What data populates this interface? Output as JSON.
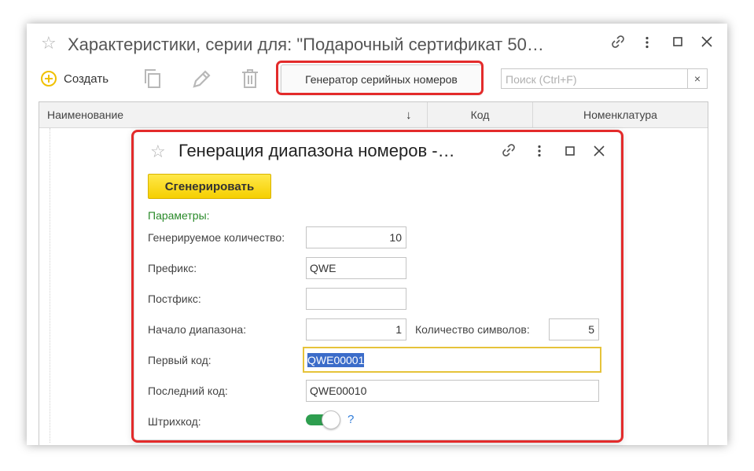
{
  "main_window": {
    "title": "Характеристики, серии для: \"Подарочный сертификат 50…",
    "toolbar": {
      "create_label": "Создать",
      "generator_button_label": "Генератор серийных номеров",
      "search_placeholder": "Поиск (Ctrl+F)",
      "search_clear": "×"
    },
    "grid": {
      "columns": [
        "Наименование",
        "Код",
        "Номенклатура"
      ],
      "sort_indicator": "↓"
    }
  },
  "dialog": {
    "title": "Генерация диапазона номеров -…",
    "generate_button_label": "Сгенерировать",
    "params_group_label": "Параметры:",
    "fields": {
      "quantity_label": "Генерируемое количество:",
      "quantity_value": "10",
      "prefix_label": "Префикс:",
      "prefix_value": "QWE",
      "postfix_label": "Постфикс:",
      "postfix_value": "",
      "range_start_label": "Начало диапазона:",
      "range_start_value": "1",
      "symbols_count_label": "Количество символов:",
      "symbols_count_value": "5",
      "first_code_label": "Первый код:",
      "first_code_value": "QWE00001",
      "last_code_label": "Последний код:",
      "last_code_value": "QWE00010",
      "barcode_label": "Штрихкод:",
      "barcode_enabled": true,
      "help_mark": "?"
    }
  },
  "colors": {
    "highlight_frame": "#e32b2b",
    "generate_button": "#f5cf00",
    "params_label": "#2a8a2a",
    "toggle_on": "#2e9e4f",
    "selection": "#3b6cc9"
  }
}
